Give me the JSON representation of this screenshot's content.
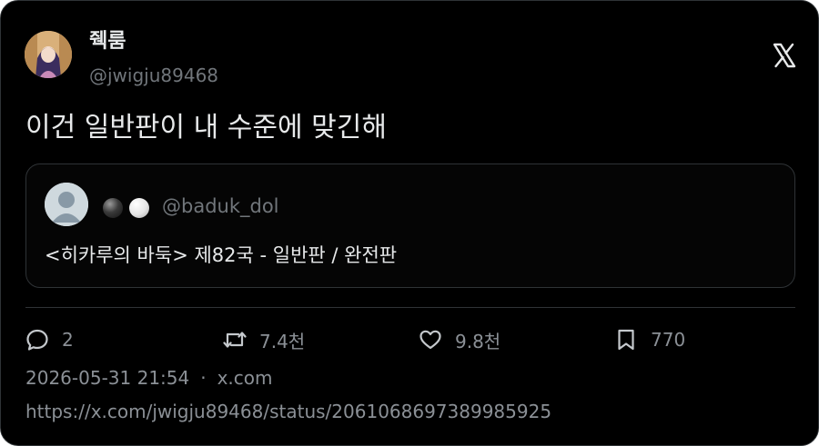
{
  "author": {
    "display_name": "줵룸",
    "handle": "@jwigju89468"
  },
  "brand": {
    "logo_icon": "x-logo-icon"
  },
  "tweet": {
    "text": "이건 일반판이 내 수준에 맞긴해"
  },
  "quoted_tweet": {
    "emoji_icons": [
      "black-go-stone-icon",
      "white-go-stone-icon"
    ],
    "handle": "@baduk_dol",
    "text": "<히카루의 바둑> 제82국 - 일반판 / 완전판"
  },
  "actions": {
    "replies": "2",
    "retweets": "7.4천",
    "likes": "9.8천",
    "bookmarks": "770"
  },
  "meta": {
    "timestamp": "2026-05-31 21:54",
    "separator": "·",
    "source": "x.com"
  },
  "url": "https://x.com/jwigju89468/status/2061068697389985925",
  "colors": {
    "background": "#000000",
    "primary_text": "#e7e9ea",
    "secondary_text": "#71767b",
    "border": "#2f3336"
  }
}
